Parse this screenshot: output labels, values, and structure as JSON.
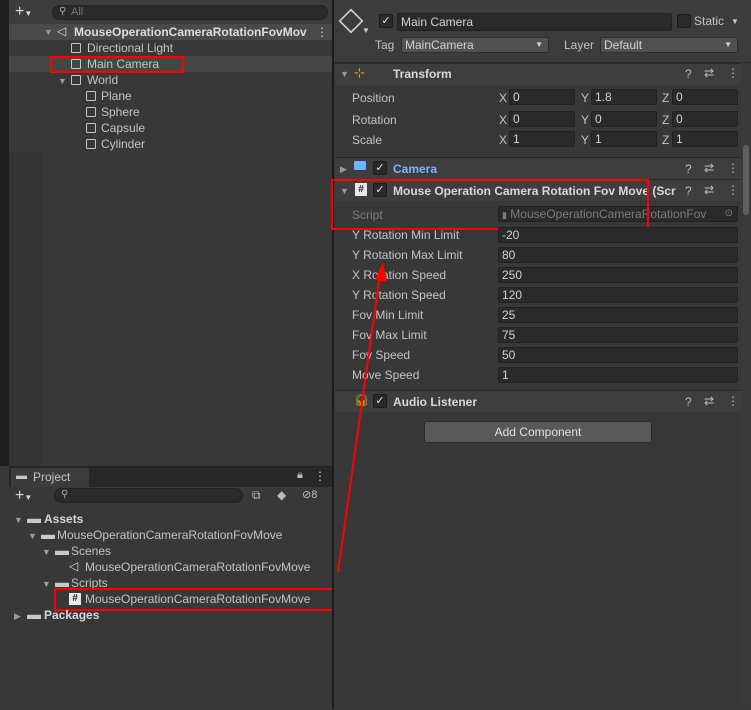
{
  "hierarchy": {
    "search_placeholder": "All",
    "items": [
      {
        "label": "MouseOperationCameraRotationFovMov",
        "kind": "scene"
      },
      {
        "label": "Directional Light",
        "kind": "object"
      },
      {
        "label": "Main Camera",
        "kind": "object"
      },
      {
        "label": "World",
        "kind": "object"
      },
      {
        "label": "Plane",
        "kind": "object"
      },
      {
        "label": "Sphere",
        "kind": "object"
      },
      {
        "label": "Capsule",
        "kind": "object"
      },
      {
        "label": "Cylinder",
        "kind": "object"
      }
    ]
  },
  "project": {
    "tab_label": "Project",
    "hidden_count": "8",
    "tree": [
      {
        "label": "Assets"
      },
      {
        "label": "MouseOperationCameraRotationFovMove"
      },
      {
        "label": "Scenes"
      },
      {
        "label": "MouseOperationCameraRotationFovMove"
      },
      {
        "label": "Scripts"
      },
      {
        "label": "MouseOperationCameraRotationFovMove"
      },
      {
        "label": "Packages"
      }
    ]
  },
  "inspector": {
    "object_name": "Main Camera",
    "static_label": "Static",
    "tag_label": "Tag",
    "tag_value": "MainCamera",
    "layer_label": "Layer",
    "layer_value": "Default",
    "transform": {
      "title": "Transform",
      "rows": [
        {
          "label": "Position",
          "x": "0",
          "y": "1.8",
          "z": "0"
        },
        {
          "label": "Rotation",
          "x": "0",
          "y": "0",
          "z": "0"
        },
        {
          "label": "Scale",
          "x": "1",
          "y": "1",
          "z": "1"
        }
      ],
      "axis_x": "X",
      "axis_y": "Y",
      "axis_z": "Z"
    },
    "camera_title": "Camera",
    "script_component": {
      "title": "Mouse Operation Camera Rotation Fov Move (Scr",
      "script_label": "Script",
      "script_value": "MouseOperationCameraRotationFov",
      "fields": [
        {
          "label": "Y Rotation Min Limit",
          "value": "-20"
        },
        {
          "label": "Y Rotation Max Limit",
          "value": "80"
        },
        {
          "label": "X Rotation Speed",
          "value": "250"
        },
        {
          "label": "Y Rotation Speed",
          "value": "120"
        },
        {
          "label": "Fov Min Limit",
          "value": "25"
        },
        {
          "label": "Fov Max Limit",
          "value": "75"
        },
        {
          "label": "Fov Speed",
          "value": "50"
        },
        {
          "label": "Move Speed",
          "value": "1"
        }
      ]
    },
    "audio_title": "Audio Listener",
    "add_component": "Add Component"
  },
  "colors": {
    "panel_bg": "#383838",
    "highlight_red": "#ff0000",
    "camera_blue": "#7fb4ff"
  }
}
